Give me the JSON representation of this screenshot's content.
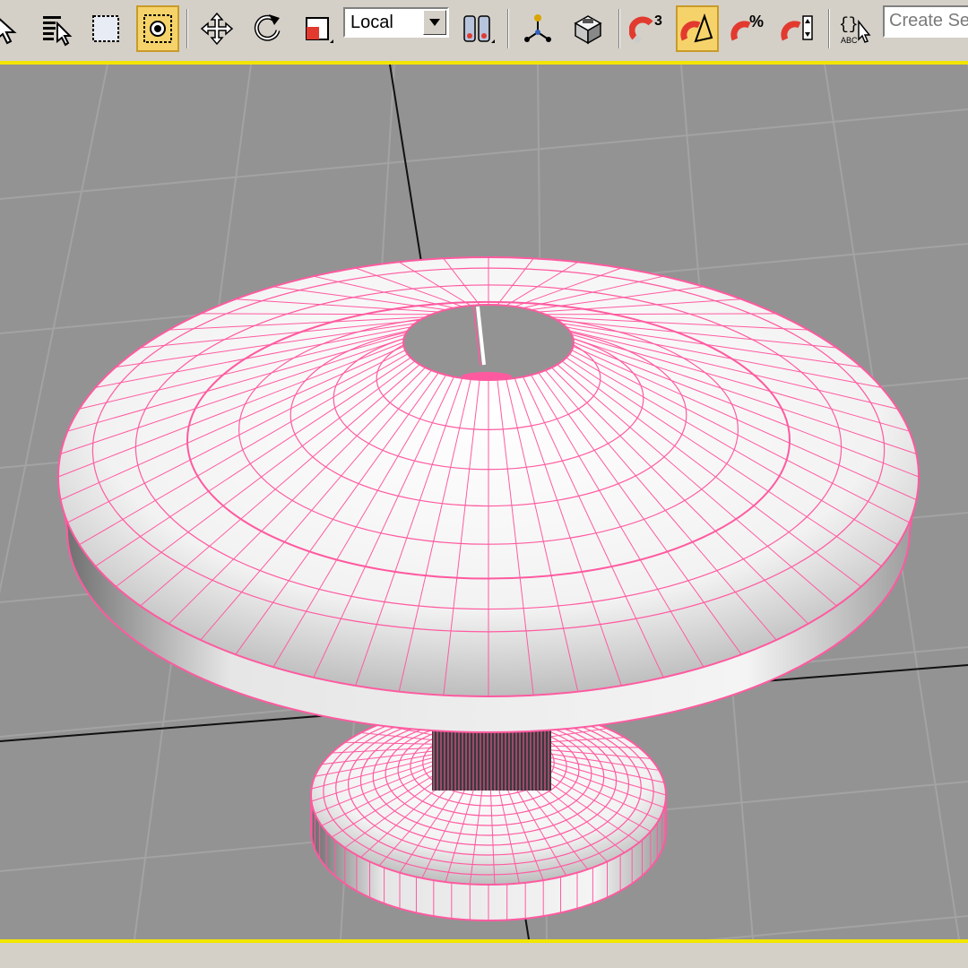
{
  "toolbar": {
    "reference_coordinate_system": "Local",
    "selection_set_placeholder": "Create Sele",
    "snap_toggle_label": "3",
    "percent_snap_label": "%",
    "edit_named_selection_label": "ABC",
    "tools": [
      {
        "name": "select-object",
        "icon": "arrow-cursor-icon",
        "active": false
      },
      {
        "name": "select-by-name",
        "icon": "list-cursor-icon",
        "active": false
      },
      {
        "name": "rectangular-selection-region",
        "icon": "dashed-rectangle-icon",
        "active": false
      },
      {
        "name": "window-crossing-toggle",
        "icon": "crossing-circle-icon",
        "active": true
      },
      {
        "name": "select-and-move",
        "icon": "move-arrows-icon",
        "active": false
      },
      {
        "name": "select-and-rotate",
        "icon": "rotate-icon",
        "active": false
      },
      {
        "name": "select-and-scale",
        "icon": "scale-box-icon",
        "active": false
      },
      {
        "name": "use-pivot-point-center",
        "icon": "pivot-center-icon",
        "active": false
      },
      {
        "name": "select-and-manipulate",
        "icon": "manipulate-icon",
        "active": false
      },
      {
        "name": "keyboard-shortcut-override",
        "icon": "cube-icon",
        "active": false
      },
      {
        "name": "snaps-toggle",
        "icon": "magnet-icon",
        "active": false
      },
      {
        "name": "angle-snap-toggle",
        "icon": "angle-magnet-icon",
        "active": true
      },
      {
        "name": "percent-snap-toggle",
        "icon": "percent-magnet-icon",
        "active": false
      },
      {
        "name": "spinner-snap-toggle",
        "icon": "spinner-magnet-icon",
        "active": false
      },
      {
        "name": "edit-named-selection-sets",
        "icon": "braces-cursor-icon",
        "active": false
      }
    ]
  },
  "viewport": {
    "object": "pedestal-table",
    "wireframe_color": "#ff5aa0",
    "background_color": "#939393",
    "grid_color": "#a3a3a3",
    "active_border_color": "#f2e600"
  }
}
